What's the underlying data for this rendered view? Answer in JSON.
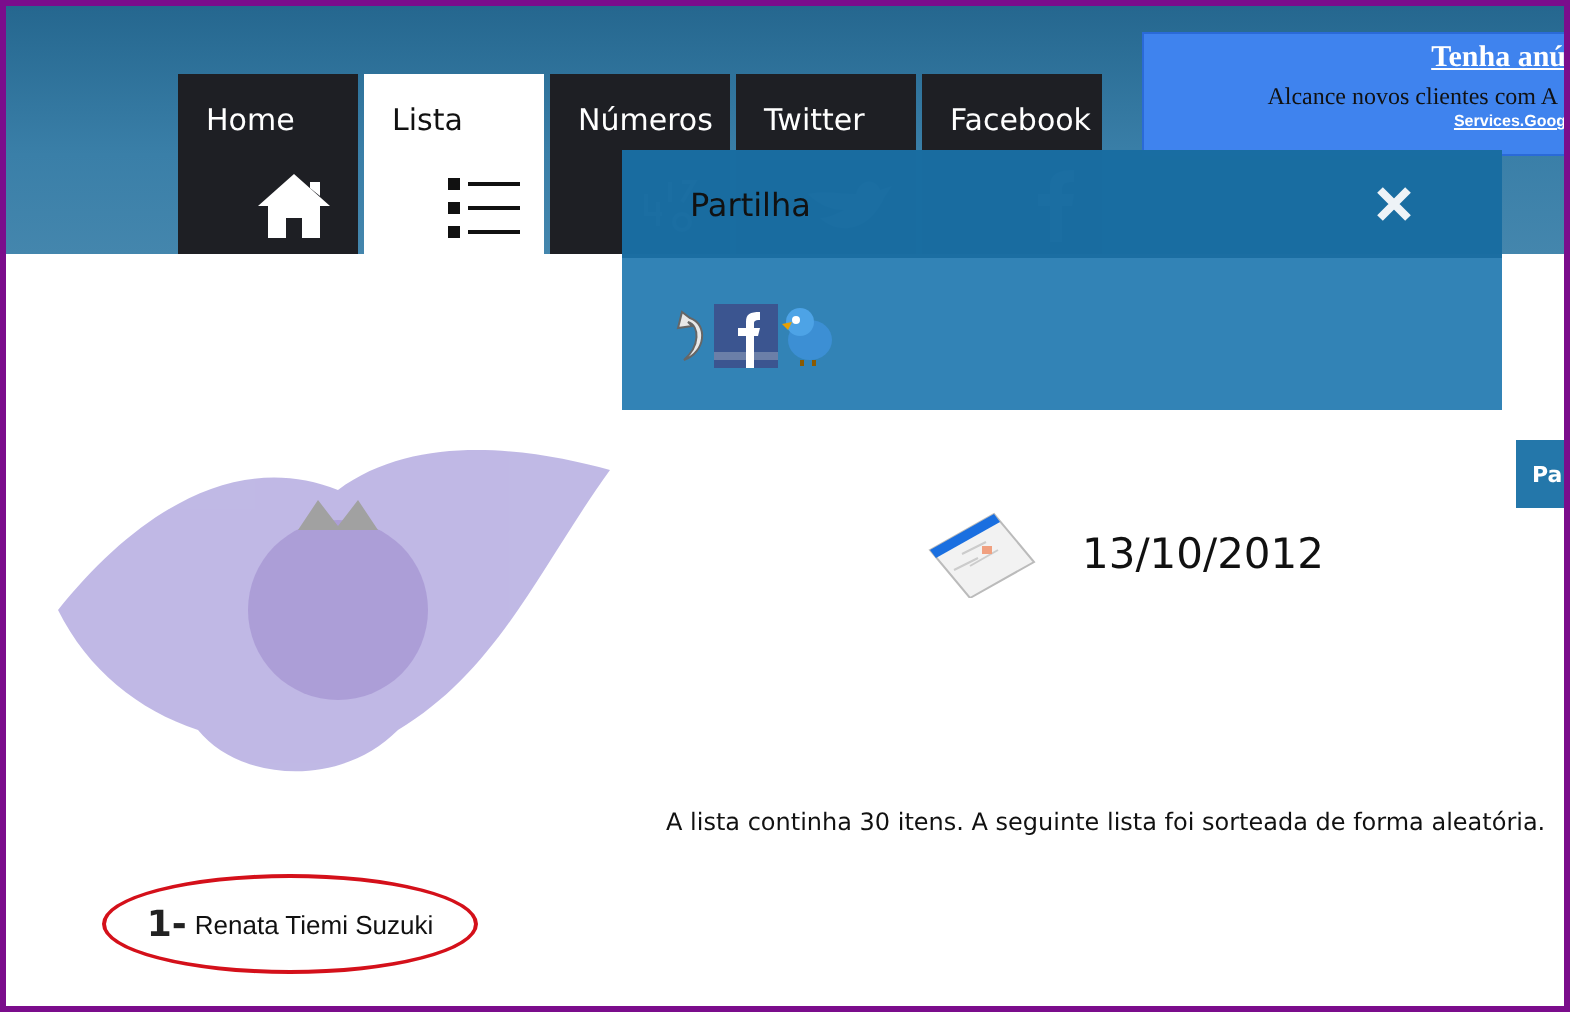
{
  "tabs": [
    {
      "label": "Home",
      "kind": "home",
      "selected": false
    },
    {
      "label": "Lista",
      "kind": "list",
      "selected": true
    },
    {
      "label": "Números",
      "kind": "numbers",
      "selected": false
    },
    {
      "label": "Twitter",
      "kind": "bird",
      "selected": false
    },
    {
      "label": "Facebook",
      "kind": "letter",
      "selected": false
    }
  ],
  "ad": {
    "title": "Tenha anú",
    "text": "Alcance novos clientes com A",
    "link": "Services.Goog"
  },
  "share_panel": {
    "title": "Partilha"
  },
  "share_tab": {
    "label": "Pa"
  },
  "date": "13/10/2012",
  "summary": "A lista continha 30 itens. A seguinte lista foi sorteada de forma aleatória.",
  "results": [
    {
      "number": "1-",
      "name": "Renata Tiemi Suzuki",
      "circled": true
    }
  ]
}
